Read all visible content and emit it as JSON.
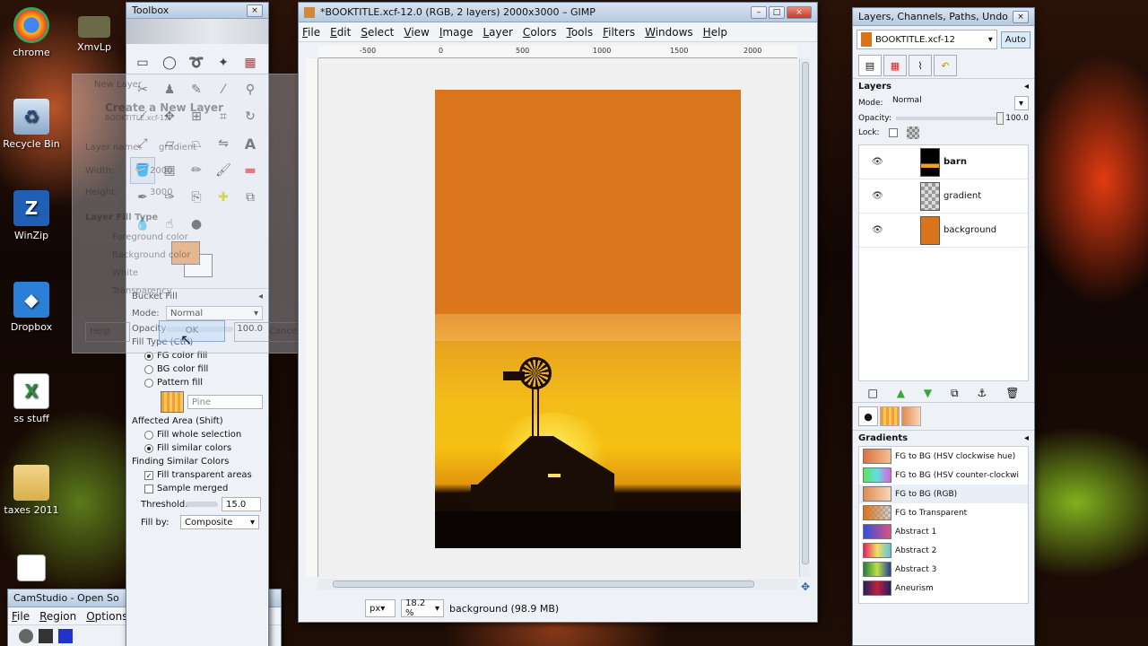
{
  "desktop": {
    "icons": [
      {
        "label": "chrome",
        "glyph": "◉",
        "color": "#d93025"
      },
      {
        "label": "XmvLp",
        "glyph": "▣",
        "color": "#5a5a3a"
      },
      {
        "label": "Recycle Bin",
        "glyph": "♻",
        "color": "#8aa7c8"
      },
      {
        "label": "WinZip",
        "glyph": "Z",
        "color": "#1f5fb5"
      },
      {
        "label": "Dropbox",
        "glyph": "◆",
        "color": "#2b7fd6"
      },
      {
        "label": "ss stuff",
        "glyph": "X",
        "color": "#2f8a3d"
      },
      {
        "label": "taxes 2011",
        "glyph": "▤",
        "color": "#d9b04a"
      }
    ]
  },
  "toolbox": {
    "title": "Toolbox",
    "bucket_fill": {
      "title": "Bucket Fill",
      "mode_label": "Mode:",
      "mode_value": "Normal",
      "opacity_label": "Opacity",
      "opacity_value": "100.0",
      "fill_type_label": "Fill Type  (Ctrl)",
      "fg_fill": "FG color fill",
      "bg_fill": "BG color fill",
      "pattern_fill": "Pattern fill",
      "pattern_name": "Pine",
      "affected_area_label": "Affected Area  (Shift)",
      "fill_whole": "Fill whole selection",
      "fill_similar": "Fill similar colors",
      "finding_label": "Finding Similar Colors",
      "fill_transparent": "Fill transparent areas",
      "sample_merged": "Sample merged",
      "threshold_label": "Threshold:",
      "threshold_value": "15.0",
      "fill_by_label": "Fill by:",
      "fill_by_value": "Composite"
    }
  },
  "new_layer_dialog": {
    "title": "New Layer",
    "heading": "Create a New Layer",
    "subheading": "BOOKTITLE.xcf-12",
    "layer_name_label": "Layer name:",
    "layer_name_value": "gradient",
    "width_label": "Width:",
    "width_value": "2000",
    "height_label": "Height:",
    "height_value": "3000",
    "fill_type_label": "Layer Fill Type",
    "options": [
      "Foreground color",
      "Background color",
      "White",
      "Transparency"
    ],
    "help": "Help",
    "ok": "OK",
    "cancel": "Cancel"
  },
  "image_window": {
    "title": "*BOOKTITLE.xcf-12.0 (RGB, 2 layers) 2000x3000 – GIMP",
    "menu": [
      "File",
      "Edit",
      "Select",
      "View",
      "Image",
      "Layer",
      "Colors",
      "Tools",
      "Filters",
      "Windows",
      "Help"
    ],
    "ruler_labels": [
      "-500",
      "0",
      "500",
      "1000",
      "1500",
      "2000"
    ],
    "unit": "px",
    "zoom": "18.2 %",
    "status": "background (98.9 MB)"
  },
  "layers_window": {
    "title": "Layers, Channels, Paths, Undo - Br...",
    "image_selector": "BOOKTITLE.xcf-12",
    "auto": "Auto",
    "layers_label": "Layers",
    "mode_label": "Mode:",
    "mode_value": "Normal",
    "opacity_label": "Opacity:",
    "opacity_value": "100.0",
    "opacity_level": 1.0,
    "lock_label": "Lock:",
    "layers": [
      {
        "name": "barn",
        "thumb": "barn"
      },
      {
        "name": "gradient",
        "thumb": "checker"
      },
      {
        "name": "background",
        "thumb": "#d9741a"
      }
    ],
    "gradients_label": "Gradients",
    "gradients": [
      {
        "name": "FG to BG (HSV clockwise hue)",
        "colors": [
          "#e07040",
          "#f0c090"
        ]
      },
      {
        "name": "FG to BG (HSV counter-clockwi",
        "colors": [
          "#60e060",
          "#e060e0"
        ]
      },
      {
        "name": "FG to BG (RGB)",
        "colors": [
          "#e08a50",
          "#f8d8b8"
        ]
      },
      {
        "name": "FG to Transparent",
        "colors": [
          "#d9741a",
          "#9a9a9a"
        ]
      },
      {
        "name": "Abstract 1",
        "colors": [
          "#3050e0",
          "#e05080"
        ]
      },
      {
        "name": "Abstract 2",
        "colors": [
          "#e02060",
          "#60c0e0"
        ]
      },
      {
        "name": "Abstract 3",
        "colors": [
          "#208040",
          "#c0e040"
        ]
      },
      {
        "name": "Aneurism",
        "colors": [
          "#202060",
          "#c02040"
        ]
      }
    ]
  },
  "taskbar": {
    "camstudio_title": "CamStudio - Open So",
    "camstudio_menu": [
      "File",
      "Region",
      "Options"
    ]
  },
  "colors": {
    "fg_color": "#e8a060",
    "bg_color": "#ffffff",
    "canvas_bg": "#f0f0f0"
  }
}
